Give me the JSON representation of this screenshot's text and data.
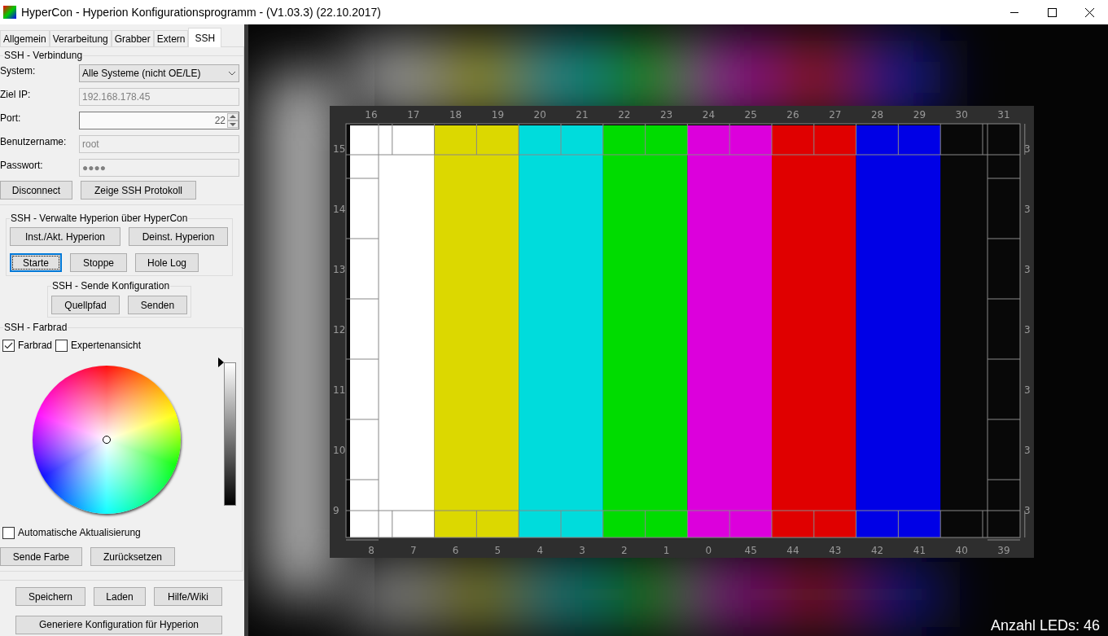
{
  "window": {
    "title": "HyperCon - Hyperion Konfigurationsprogramm - (V1.03.3) (22.10.2017)"
  },
  "tabs": [
    {
      "label": "Allgemein",
      "selected": false
    },
    {
      "label": "Verarbeitung",
      "selected": false
    },
    {
      "label": "Grabber",
      "selected": false
    },
    {
      "label": "Extern",
      "selected": false
    },
    {
      "label": "SSH",
      "selected": true
    }
  ],
  "connection": {
    "title": "SSH - Verbindung",
    "fields": [
      {
        "label": "System:",
        "kind": "select",
        "value": "Alle Systeme (nicht OE/LE)",
        "disabled": false
      },
      {
        "label": "Ziel IP:",
        "kind": "text",
        "value": "192.168.178.45",
        "disabled": true
      },
      {
        "label": "Port:",
        "kind": "spin",
        "value": "22",
        "disabled": false
      },
      {
        "label": "Benutzername:",
        "kind": "text",
        "value": "root",
        "disabled": true
      },
      {
        "label": "Passwort:",
        "kind": "text",
        "value": "●●●●",
        "disabled": true
      }
    ],
    "buttons": [
      "Disconnect",
      "Zeige SSH Protokoll"
    ]
  },
  "manage": {
    "title": "SSH - Verwalte Hyperion über HyperCon",
    "buttons": [
      {
        "label": "Inst./Akt. Hyperion",
        "focused": false
      },
      {
        "label": "Deinst. Hyperion",
        "focused": false
      },
      {
        "label": "Starte",
        "focused": true
      },
      {
        "label": "Stoppe",
        "focused": false
      },
      {
        "label": "Hole Log",
        "focused": false
      }
    ]
  },
  "send_config": {
    "title": "SSH - Sende Konfiguration",
    "buttons": [
      "Quellpfad",
      "Senden"
    ]
  },
  "color_wheel": {
    "title": "SSH - Farbrad",
    "options": [
      {
        "label": "Farbrad",
        "checked": true
      },
      {
        "label": "Expertenansicht",
        "checked": false
      }
    ],
    "brightness": {
      "level": 1
    },
    "auto_update": {
      "label": "Automatische Aktualisierung",
      "checked": false
    },
    "buttons": [
      "Sende Farbe",
      "Zurücksetzen"
    ]
  },
  "footer": {
    "buttons": [
      "Speichern",
      "Laden",
      "Hilfe/Wiki"
    ],
    "generate": "Generiere Konfiguration für Hyperion"
  },
  "preview": {
    "top_labels": [
      "16",
      "17",
      "18",
      "19",
      "20",
      "21",
      "22",
      "23",
      "24",
      "25",
      "26",
      "27",
      "28",
      "29",
      "30",
      "31"
    ],
    "bottom_labels": [
      "8",
      "7",
      "6",
      "5",
      "4",
      "3",
      "2",
      "1",
      "0",
      "45",
      "44",
      "43",
      "42",
      "41",
      "40",
      "39"
    ],
    "left_labels": [
      "15",
      "14",
      "13",
      "12",
      "11",
      "10",
      "9"
    ],
    "right_labels": [
      "3",
      "3",
      "3",
      "3",
      "3",
      "3",
      "3"
    ],
    "led_count": "Anzahl LEDs: 46"
  }
}
